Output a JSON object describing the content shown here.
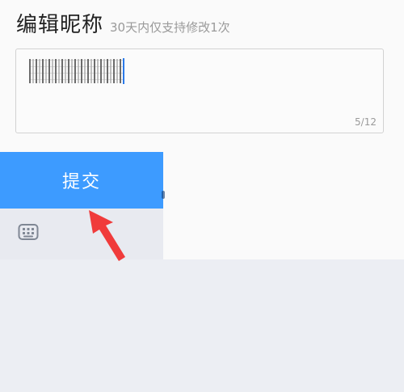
{
  "header": {
    "title": "编辑昵称",
    "hint": "30天内仅支持修改1次"
  },
  "nickname": {
    "counter": "5/12"
  },
  "submit": {
    "label": "提交"
  },
  "icons": {
    "keyboard": "keyboard-icon",
    "arrow": "red-arrow-annotation"
  },
  "colors": {
    "submit_bg": "#3d9bff",
    "caret": "#2b79e8",
    "arrow": "#f03b3b"
  }
}
